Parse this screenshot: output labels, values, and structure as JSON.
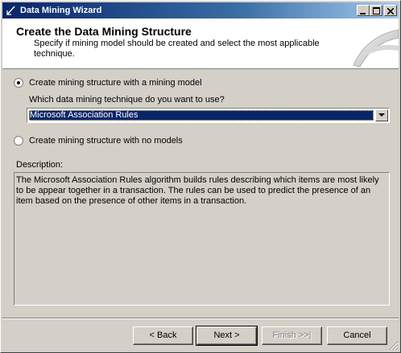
{
  "window": {
    "title": "Data Mining Wizard",
    "controls": {
      "minimize": "_",
      "maximize": "□",
      "close": "✕"
    }
  },
  "header": {
    "title": "Create the Data Mining Structure",
    "subtitle": "Specify if mining model should be created and select the most applicable technique."
  },
  "options": {
    "with_model_label": "Create mining structure with a mining  model",
    "with_model_selected": true,
    "technique_prompt": "Which data mining technique do you want to use?",
    "technique_selected": "Microsoft Association Rules",
    "no_models_label": "Create mining structure with no models",
    "no_models_selected": false
  },
  "description": {
    "label": "Description:",
    "text": "The Microsoft Association Rules algorithm builds rules describing which items are most likely to be appear together in a transaction. The rules can be used to predict the presence of an item based on the presence of other items in a transaction."
  },
  "buttons": {
    "back": "< Back",
    "next": "Next >",
    "finish": "Finish >>|",
    "cancel": "Cancel"
  },
  "icons": {
    "app": "wizard-icon",
    "header_art": "mining-pick-icon",
    "dropdown": "chevron-down-icon"
  }
}
